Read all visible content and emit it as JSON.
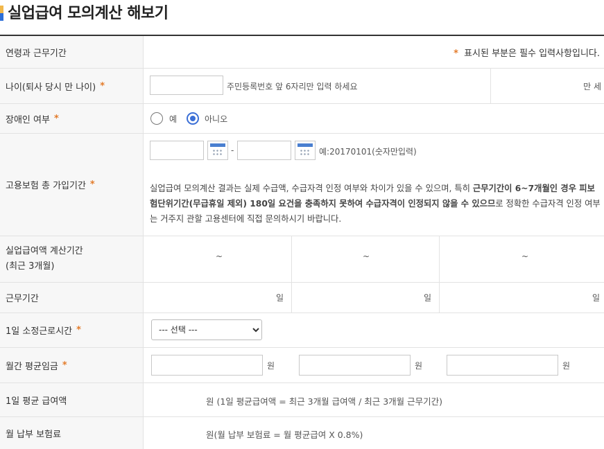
{
  "page": {
    "title": "실업급여 모의계산 해보기"
  },
  "header_row": {
    "label": "연령과 근무기간",
    "required_note": "표시된 부분은 필수 입력사항입니다.",
    "star": "*"
  },
  "age": {
    "label": "나이(퇴사 당시 만 나이)",
    "hint": "주민등록번호 앞 6자리만 입력 하세요",
    "unit": "만 세",
    "value": ""
  },
  "disability": {
    "label": "장애인 여부",
    "options": [
      "예",
      "아니오"
    ],
    "selected": "아니오"
  },
  "insurance": {
    "label": "고용보험 총 가입기간",
    "date_sep": "-",
    "date_hint": "예:20170101(숫자만입력)",
    "notice_p1": "실업급여 모의계산 결과는 실제 수급액, 수급자격 인정 여부와 차이가 있을 수 있으며, 특히 ",
    "notice_bold": "근무기간이 6~7개월인 경우 피보험단위기간(무급휴일 제외) 180일 요건을 충족하지 못하여 수급자격이 인정되지 않을 수 있으므",
    "notice_p2": "로 정확한 수급자격 인정 여부는 거주지 관할 고용센터에 직접 문의하시기 바랍니다."
  },
  "calc_period": {
    "label_line1": "실업급여액 계산기간",
    "label_line2": "(최근 3개월)",
    "cells": [
      "~",
      "~",
      "~"
    ]
  },
  "work_days": {
    "label": "근무기간",
    "cells": [
      "일",
      "일",
      "일"
    ]
  },
  "daily_hours": {
    "label": "1일 소정근로시간",
    "select_value": "--- 선택 ---"
  },
  "monthly_wage": {
    "label": "월간 평균임금",
    "unit": "원"
  },
  "daily_benefit": {
    "label": "1일 평균 급여액",
    "text": "원 (1일 평균급여액 = 최근 3개월 급여액 / 최근 3개월 근무기간)"
  },
  "premium": {
    "label": "월 납부 보험료",
    "text": "원(월 납부 보험료 = 월 평균급여 X 0.8%)"
  }
}
